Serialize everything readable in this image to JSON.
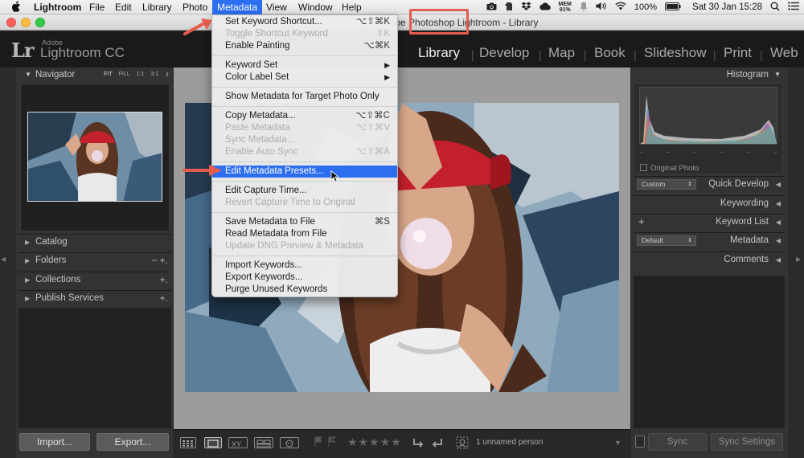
{
  "menubar": {
    "app": "Lightroom",
    "items": [
      "File",
      "Edit",
      "Library",
      "Photo",
      "Metadata",
      "View",
      "Window",
      "Help"
    ],
    "active": "Metadata",
    "status": {
      "mem_label": "MEM",
      "mem_value": "91%",
      "battery": "100%",
      "datetime": "Sat 30 Jan  15:28"
    }
  },
  "window": {
    "title": "Adobe Photoshop Lightroom - Library"
  },
  "identity": {
    "logo": "Lr",
    "brand": "Adobe",
    "product": "Lightroom CC"
  },
  "modules": [
    "Library",
    "Develop",
    "Map",
    "Book",
    "Slideshow",
    "Print",
    "Web"
  ],
  "selected_module": "Library",
  "left_panel": {
    "navigator": {
      "title": "Navigator",
      "zoom_options": [
        "FIT",
        "FILL",
        "1:1",
        "3:1"
      ]
    },
    "sections": [
      {
        "label": "Catalog",
        "actions": ""
      },
      {
        "label": "Folders",
        "actions": "−  +."
      },
      {
        "label": "Collections",
        "actions": "+."
      },
      {
        "label": "Publish Services",
        "actions": "+."
      }
    ],
    "import_label": "Import...",
    "export_label": "Export..."
  },
  "metadata_menu": {
    "items": [
      {
        "label": "Set Keyword Shortcut...",
        "shortcut": "⌥⇧⌘K",
        "disabled": false
      },
      {
        "label": "Toggle Shortcut Keyword",
        "shortcut": "⇧K",
        "disabled": true
      },
      {
        "label": "Enable Painting",
        "shortcut": "⌥⌘K",
        "disabled": false
      },
      {
        "label": "Keyword Set",
        "shortcut": "",
        "disabled": false,
        "submenu": true
      },
      {
        "label": "Color Label Set",
        "shortcut": "",
        "disabled": false,
        "submenu": true
      },
      {
        "label": "Show Metadata for Target Photo Only",
        "shortcut": "",
        "disabled": false
      },
      {
        "label": "Copy Metadata...",
        "shortcut": "⌥⇧⌘C",
        "disabled": false
      },
      {
        "label": "Paste Metadata",
        "shortcut": "⌥⇧⌘V",
        "disabled": true
      },
      {
        "label": "Sync Metadata...",
        "shortcut": "",
        "disabled": true
      },
      {
        "label": "Enable Auto Sync",
        "shortcut": "⌥⇧⌘A",
        "disabled": true
      },
      {
        "label": "Edit Metadata Presets...",
        "shortcut": "",
        "disabled": false,
        "highlighted": true
      },
      {
        "label": "Edit Capture Time...",
        "shortcut": "",
        "disabled": false
      },
      {
        "label": "Revert Capture Time to Original",
        "shortcut": "",
        "disabled": true
      },
      {
        "label": "Save Metadata to File",
        "shortcut": "⌘S",
        "disabled": false
      },
      {
        "label": "Read Metadata from File",
        "shortcut": "",
        "disabled": false
      },
      {
        "label": "Update DNG Preview & Metadata",
        "shortcut": "",
        "disabled": true
      },
      {
        "label": "Import Keywords...",
        "shortcut": "",
        "disabled": false
      },
      {
        "label": "Export Keywords...",
        "shortcut": "",
        "disabled": false
      },
      {
        "label": "Purge Unused Keywords",
        "shortcut": "",
        "disabled": false
      }
    ]
  },
  "toolbar": {
    "person_text": "1 unnamed person",
    "rating": 0
  },
  "right_panel": {
    "histogram_title": "Histogram",
    "original_photo_label": "Original Photo",
    "sections": [
      {
        "label": "Quick Develop",
        "select": "Custom"
      },
      {
        "label": "Keywording"
      },
      {
        "label": "Keyword List",
        "plus": "+"
      },
      {
        "label": "Metadata",
        "select": "Default"
      },
      {
        "label": "Comments"
      }
    ],
    "sync_label": "Sync",
    "sync_settings_label": "Sync Settings"
  },
  "colors": {
    "highlight_blue": "#2d6ef0",
    "annotation_red": "#e45c4f"
  }
}
